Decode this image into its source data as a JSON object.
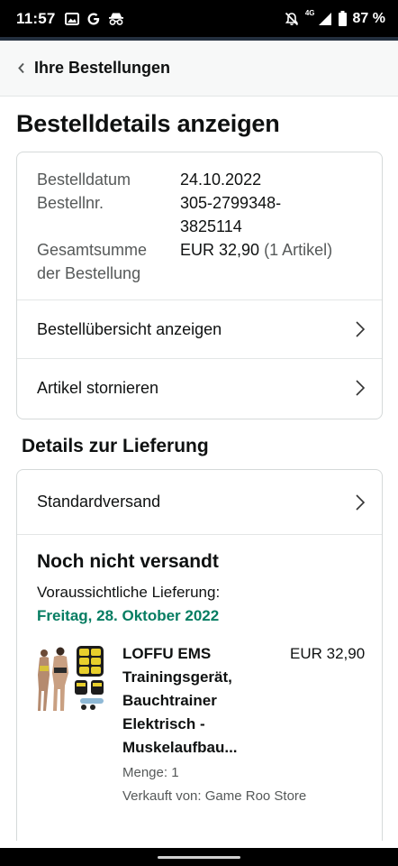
{
  "status_bar": {
    "time": "11:57",
    "network": "4G",
    "battery": "87 %",
    "icons": [
      "image-icon",
      "google-icon",
      "incognito-icon",
      "silent-icon",
      "signal-icon",
      "battery-icon"
    ]
  },
  "header": {
    "back_label": "Ihre Bestellungen"
  },
  "page_title": "Bestelldetails anzeigen",
  "order": {
    "date_label": "Bestelldatum",
    "date_value": "24.10.2022",
    "number_label": "Bestellnr.",
    "number_value_line1": "305-2799348-",
    "number_value_line2": "3825114",
    "total_label_line1": "Gesamtsumme",
    "total_label_line2": "der Bestellung",
    "total_value": "EUR 32,90",
    "total_items": "(1 Artikel)",
    "rows": [
      {
        "label": "Bestellübersicht anzeigen"
      },
      {
        "label": "Artikel stornieren"
      }
    ]
  },
  "delivery": {
    "section_title": "Details zur Lieferung",
    "shipping_method": "Standardversand",
    "status": "Noch nicht versandt",
    "eta_label": "Voraussichtliche Lieferung:",
    "eta_date": "Freitag, 28. Oktober 2022",
    "eta_color": "#067d62",
    "item": {
      "title_lines": [
        "LOFFU EMS",
        "Trainingsgerät,",
        "Bauchtrainer",
        "Elektrisch -",
        "Muskelaufbau..."
      ],
      "price": "EUR 32,90",
      "quantity": "Menge: 1",
      "seller": "Verkauft von: Game Roo Store"
    }
  }
}
